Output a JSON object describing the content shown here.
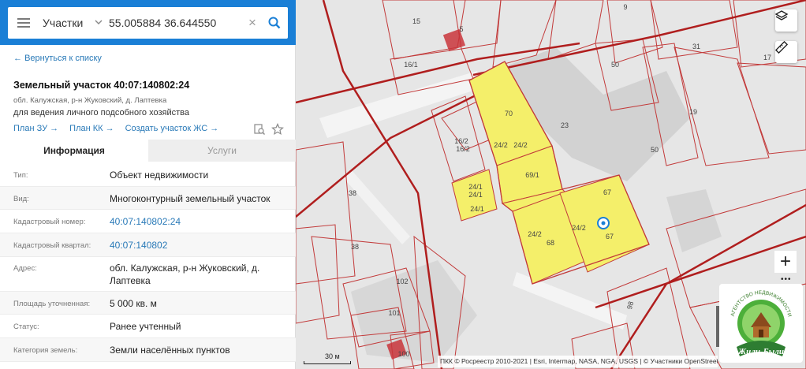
{
  "search": {
    "mode": "Участки",
    "query": "55.005884 36.644550"
  },
  "panel": {
    "back_link": "Вернуться к списку",
    "title": "Земельный участок 40:07:140802:24",
    "address_short": "обл. Калужская, р-н Жуковский, д. Лаптевка",
    "purpose": "для ведения личного подсобного хозяйства",
    "links": [
      "План ЗУ",
      "План КК",
      "Создать участок ЖС"
    ],
    "link_arrow": "→",
    "tabs": [
      "Информация",
      "Услуги"
    ],
    "properties": [
      {
        "label": "Тип:",
        "value": "Объект недвижимости"
      },
      {
        "label": "Вид:",
        "value": "Многоконтурный земельный участок"
      },
      {
        "label": "Кадастровый номер:",
        "value": "40:07:140802:24",
        "link": true
      },
      {
        "label": "Кадастровый квартал:",
        "value": "40:07:140802",
        "link": true
      },
      {
        "label": "Адрес:",
        "value": "обл. Калужская, р-н Жуковский, д. Лаптевка"
      },
      {
        "label": "Площадь уточненная:",
        "value": "5 000 кв. м"
      },
      {
        "label": "Статус:",
        "value": "Ранее учтенный"
      },
      {
        "label": "Категория земель:",
        "value": "Земли населённых пунктов"
      }
    ]
  },
  "map": {
    "parcel_labels": [
      "15",
      "5",
      "16/1",
      "9",
      "31",
      "17",
      "19",
      "50",
      "23",
      "70",
      "16/2",
      "16/2",
      "24/2",
      "24/2",
      "69/1",
      "24/1",
      "24/1",
      "24/1",
      "67",
      "38",
      "38",
      "24/2",
      "24/2",
      "68",
      "67",
      "102",
      "101",
      "100",
      "50",
      "98"
    ],
    "scale_label": "30 м",
    "attribution": "ПКК © Росреестр 2010-2021 | Esri, Intermap, NASA, NGA, USGS | © Участники OpenStreetMap",
    "zoom_in": "+",
    "zoom_more": "•••",
    "logo_text": [
      "АГЕНТСТВО НЕДВИЖИМОСТИ",
      "Жили-Были"
    ]
  },
  "colors": {
    "header": "#1a7fd6",
    "link": "#2a7ab8",
    "parcel_fill": "#f4ef6a",
    "boundary": "#c23a3a",
    "road": "#b01e1e"
  }
}
